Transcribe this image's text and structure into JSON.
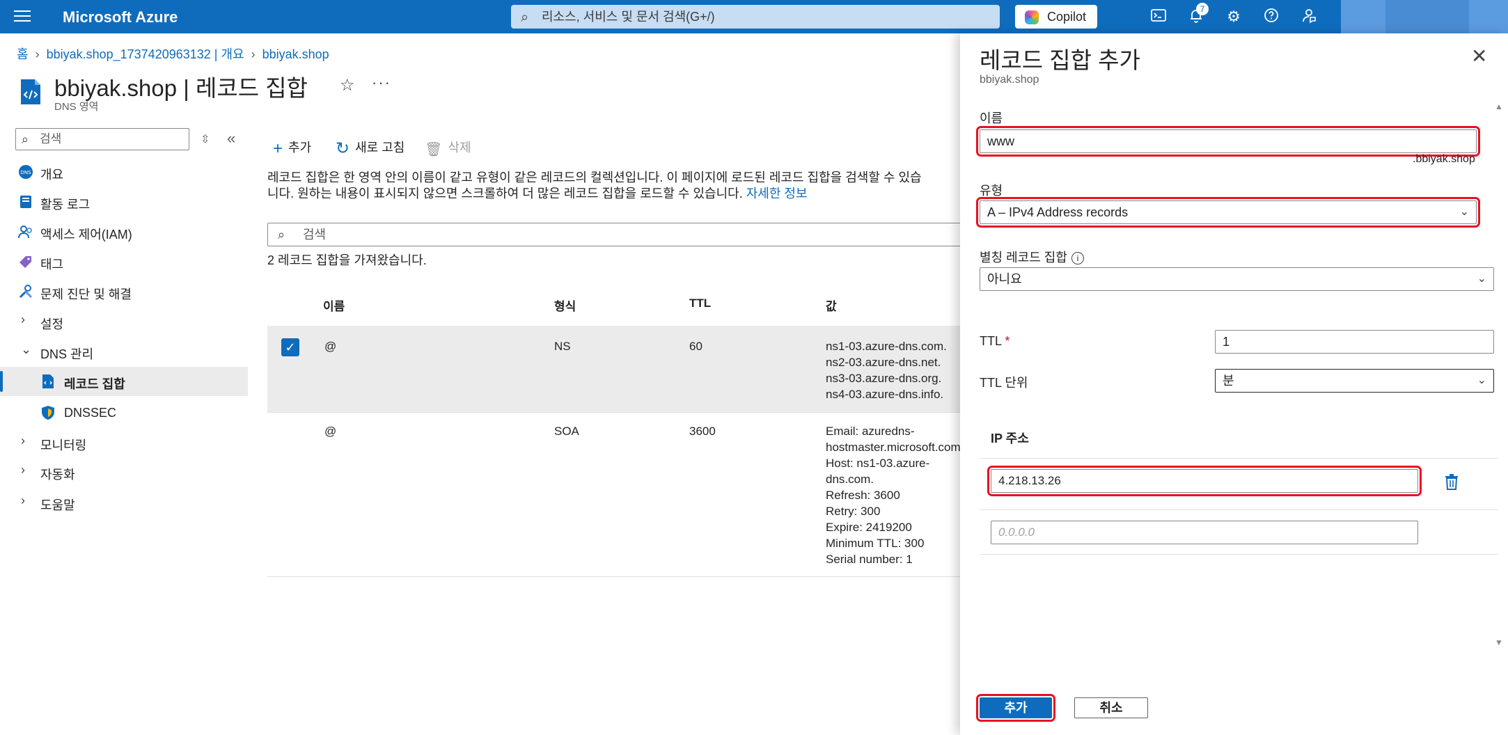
{
  "topbar": {
    "brand": "Microsoft Azure",
    "search_placeholder": "리소스, 서비스 및 문서 검색(G+/)",
    "copilot_label": "Copilot",
    "notification_count": "7",
    "color": "#0f6cbd"
  },
  "breadcrumb": {
    "items": [
      "홈",
      "bbiyak.shop_1737420963132 | 개요",
      "bbiyak.shop"
    ]
  },
  "header": {
    "title": "bbiyak.shop | 레코드 집합",
    "subtitle": "DNS 영역"
  },
  "sidebar": {
    "search_placeholder": "검색",
    "items": [
      {
        "label": "개요",
        "icon": "dns-icon"
      },
      {
        "label": "활동 로그",
        "icon": "activity-log-icon"
      },
      {
        "label": "액세스 제어(IAM)",
        "icon": "iam-icon"
      },
      {
        "label": "태그",
        "icon": "tag-icon"
      },
      {
        "label": "문제 진단 및 해결",
        "icon": "wrench-icon"
      },
      {
        "label": "설정",
        "icon": "chevron-right-icon"
      },
      {
        "label": "DNS 관리",
        "icon": "chevron-down-icon"
      },
      {
        "label": "레코드 집합",
        "icon": "record-set-icon"
      },
      {
        "label": "DNSSEC",
        "icon": "shield-icon"
      },
      {
        "label": "모니터링",
        "icon": "chevron-right-icon"
      },
      {
        "label": "자동화",
        "icon": "chevron-right-icon"
      },
      {
        "label": "도움말",
        "icon": "chevron-right-icon"
      }
    ]
  },
  "toolbar": {
    "add_label": "추가",
    "refresh_label": "새로 고침",
    "delete_label": "삭제"
  },
  "main": {
    "description_line1": "레코드 집합은 한 영역 안의 이름이 같고 유형이 같은 레코드의 컬렉션입니다. 이 페이지에 로드된 레코드 집합을 검색할 수 있습",
    "description_line2": "니다. 원하는 내용이 표시되지 않으면 스크롤하여 더 많은 레코드 집합을 로드할 수 있습니다.",
    "learn_more": "자세한 정보",
    "search_placeholder": "검색",
    "fetched_text": "2 레코드 집합을 가져왔습니다."
  },
  "table": {
    "columns": [
      "이름",
      "형식",
      "TTL",
      "값"
    ],
    "rows": [
      {
        "name": "@",
        "type": "NS",
        "ttl": "60",
        "values": [
          "ns1-03.azure-dns.com.",
          "ns2-03.azure-dns.net.",
          "ns3-03.azure-dns.org.",
          "ns4-03.azure-dns.info."
        ],
        "selected": true
      },
      {
        "name": "@",
        "type": "SOA",
        "ttl": "3600",
        "values": [
          "Email: azuredns-",
          "hostmaster.microsoft.com",
          "Host: ns1-03.azure-",
          "dns.com.",
          "Refresh: 3600",
          "Retry: 300",
          "Expire: 2419200",
          "Minimum TTL: 300",
          "Serial number: 1"
        ],
        "selected": false
      }
    ]
  },
  "panel": {
    "title": "레코드 집합 추가",
    "subtitle": "bbiyak.shop",
    "name_label": "이름",
    "name_value": "www",
    "name_suffix": ".bbiyak.shop",
    "type_label": "유형",
    "type_value": "A – IPv4 Address records",
    "alias_label": "별칭 레코드 집합",
    "alias_value": "아니요",
    "ttl_label": "TTL",
    "ttl_required": "*",
    "ttl_value": "1",
    "ttl_unit_label": "TTL 단위",
    "ttl_unit_value": "분",
    "ip_header": "IP 주소",
    "ip_value": "4.218.13.26",
    "ip_placeholder": "0.0.0.0",
    "add_button": "추가",
    "cancel_button": "취소"
  }
}
